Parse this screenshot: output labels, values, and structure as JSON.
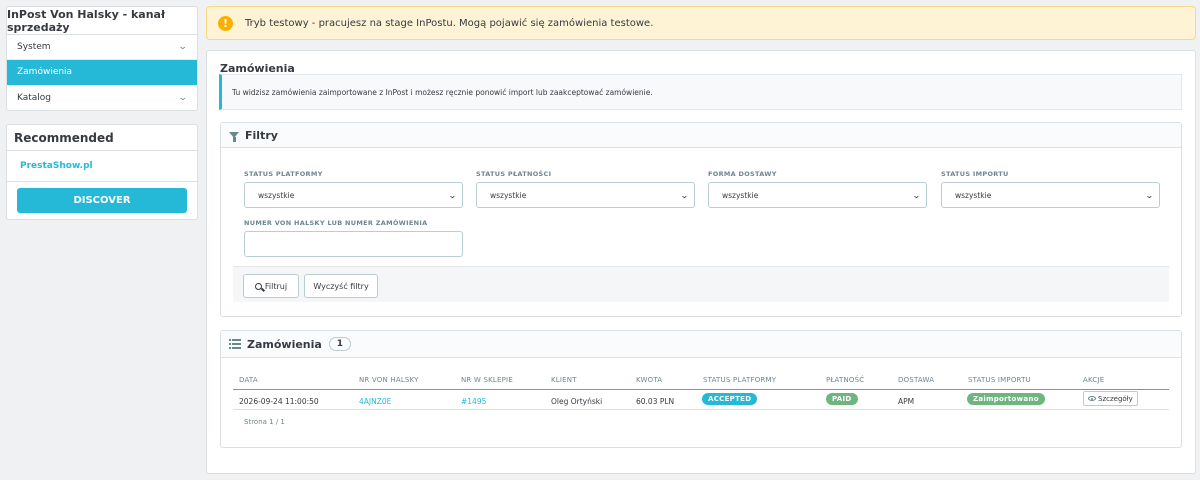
{
  "sidebar": {
    "title": "InPost Von Halsky - kanał sprzedaży",
    "menu": [
      {
        "label": "System",
        "expandable": true,
        "active": false
      },
      {
        "label": "Zamówienia",
        "expandable": false,
        "active": true
      },
      {
        "label": "Katalog",
        "expandable": true,
        "active": false
      }
    ],
    "recommended": {
      "title": "Recommended",
      "link": "PrestaShow.pl",
      "button": "DISCOVER"
    }
  },
  "alert": {
    "icon": "warning-icon",
    "text": "Tryb testowy - pracujesz na stage InPostu. Mogą pojawić się zamówienia testowe."
  },
  "main": {
    "title": "Zamówienia",
    "info": "Tu widzisz zamówienia zaimportowane z InPost i możesz ręcznie ponowić import lub zaakceptować zamówienie.",
    "filters": {
      "title": "Filtry",
      "fields": [
        {
          "label": "STATUS PLATFORMY",
          "value": "wszystkie"
        },
        {
          "label": "STATUS PŁATNOŚCI",
          "value": "wszystkie"
        },
        {
          "label": "FORMA DOSTAWY",
          "value": "wszystkie"
        },
        {
          "label": "STATUS IMPORTU",
          "value": "wszystkie"
        }
      ],
      "search": {
        "label": "NUMER VON HALSKY LUB NUMER ZAMÓWIENIA",
        "value": ""
      },
      "filter_button": "Filtruj",
      "clear_button": "Wyczyść filtry"
    },
    "orders": {
      "title": "Zamówienia",
      "count": "1",
      "columns": [
        "DATA",
        "NR VON HALSKY",
        "NR W SKLEPIE",
        "KLIENT",
        "KWOTA",
        "STATUS PLATFORMY",
        "PŁATNOŚĆ",
        "DOSTAWA",
        "STATUS IMPORTU",
        "AKCJE"
      ],
      "rows": [
        {
          "date": "2026-09-24 11:00:50",
          "vh_number": "4AJNZ0E",
          "shop_number": "#1495",
          "client": "Oleg Ortyński",
          "amount": "60.03 PLN",
          "platform_status": "ACCEPTED",
          "payment": "PAID",
          "delivery": "APM",
          "import_status": "Zaimportowano",
          "action": "Szczegóły"
        }
      ],
      "pager": "Strona 1 / 1"
    }
  },
  "colors": {
    "accent": "#25b9d7",
    "success": "#70b580",
    "warning": "#fab000"
  }
}
